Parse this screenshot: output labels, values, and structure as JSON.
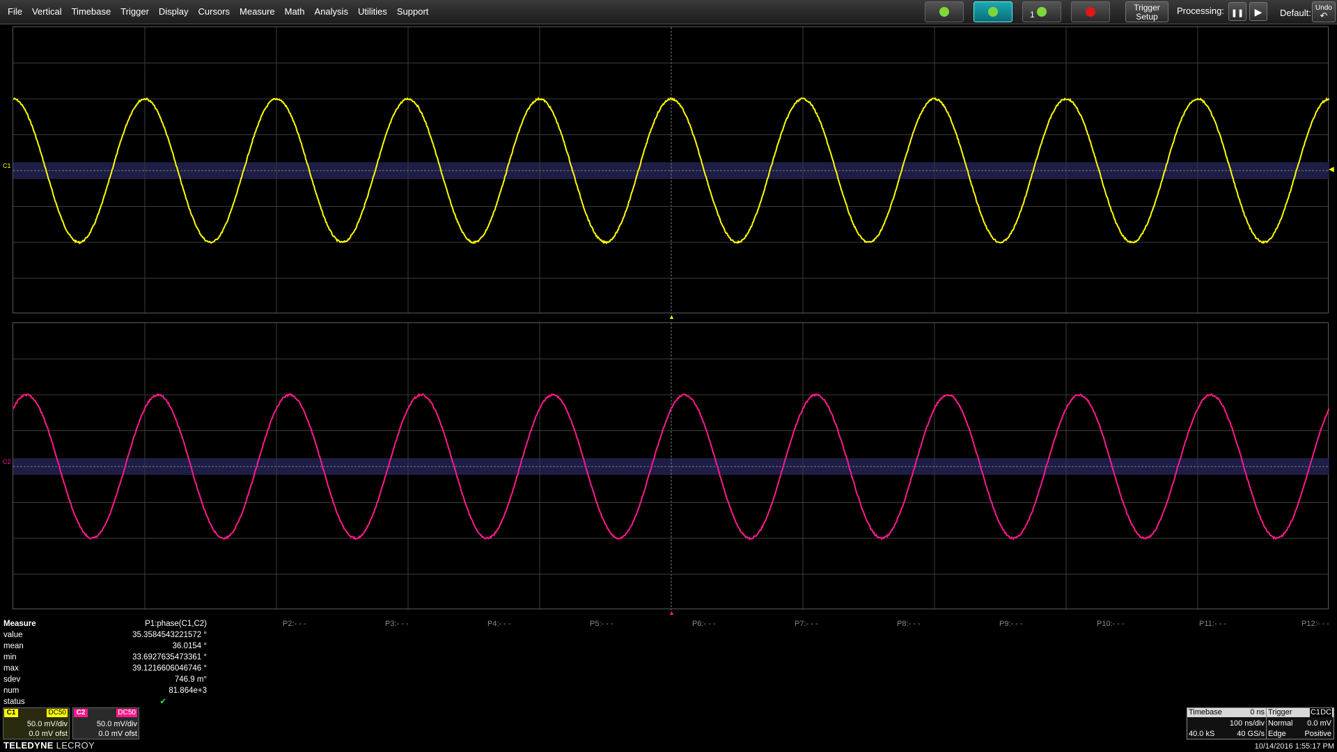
{
  "menu": [
    "File",
    "Vertical",
    "Timebase",
    "Trigger",
    "Display",
    "Cursors",
    "Measure",
    "Math",
    "Analysis",
    "Utilities",
    "Support"
  ],
  "toolbar": {
    "trigger_setup_line1": "Trigger",
    "trigger_setup_line2": "Setup",
    "processing_label": "Processing:",
    "pause_glyph": "❚❚",
    "play_glyph": "▶",
    "default_label": "Default:",
    "undo_line1": "Undo",
    "undo_arrow": "↶",
    "single_mode_digit": "1",
    "trigger_mode_buttons": [
      {
        "name": "auto-trigger-icon",
        "color": "#7fd63a"
      },
      {
        "name": "normal-trigger-icon",
        "color": "#7fd63a",
        "active": true
      },
      {
        "name": "single-trigger-icon",
        "color": "#7fd63a"
      },
      {
        "name": "stop-trigger-icon",
        "color": "#e01818"
      }
    ]
  },
  "channels": [
    {
      "id": "C1",
      "marker": "C1",
      "color": "#ffff00",
      "coupling": "DC50",
      "vdiv": "50.0 mV/div",
      "offset": "0.0 mV ofst"
    },
    {
      "id": "C2",
      "marker": "C2",
      "color": "#ff1a8c",
      "coupling": "DC50",
      "vdiv": "50.0 mV/div",
      "offset": "0.0 mV ofst"
    }
  ],
  "waveforms": {
    "cycles_on_screen": 10,
    "phase_shift_deg": 36,
    "amplitude_divisions": 2,
    "noise_fraction": 0.012
  },
  "measure": {
    "header": "Measure",
    "param_header": "P1:phase(C1,C2)",
    "rows": [
      {
        "label": "value",
        "value": "35.3584543221572 °"
      },
      {
        "label": "mean",
        "value": "36.0154 °"
      },
      {
        "label": "min",
        "value": "33.6927635473361 °"
      },
      {
        "label": "max",
        "value": "39.1216606046746 °"
      },
      {
        "label": "sdev",
        "value": "746.9 m°"
      },
      {
        "label": "num",
        "value": "81.864e+3"
      },
      {
        "label": "status",
        "value": "✔"
      }
    ],
    "other_params": [
      "P2:- - -",
      "P3:- - -",
      "P4:- - -",
      "P5:- - -",
      "P6:- - -",
      "P7:- - -",
      "P8:- - -",
      "P9:- - -",
      "P10:- - -",
      "P11:- - -",
      "P12:- - -"
    ]
  },
  "brand": {
    "bold": "TELEDYNE",
    "light": " LECROY"
  },
  "timebase": {
    "header": "Timebase",
    "delay": "0 ns",
    "tdiv": "100 ns/div",
    "samples": "40.0 kS",
    "rate": "40 GS/s"
  },
  "trigger": {
    "header": "Trigger",
    "source": "C1",
    "coupling": "DC",
    "mode": "Normal",
    "level": "0.0 mV",
    "type": "Edge",
    "slope": "Positive"
  },
  "datetime": "10/14/2016 1:55:17 PM"
}
